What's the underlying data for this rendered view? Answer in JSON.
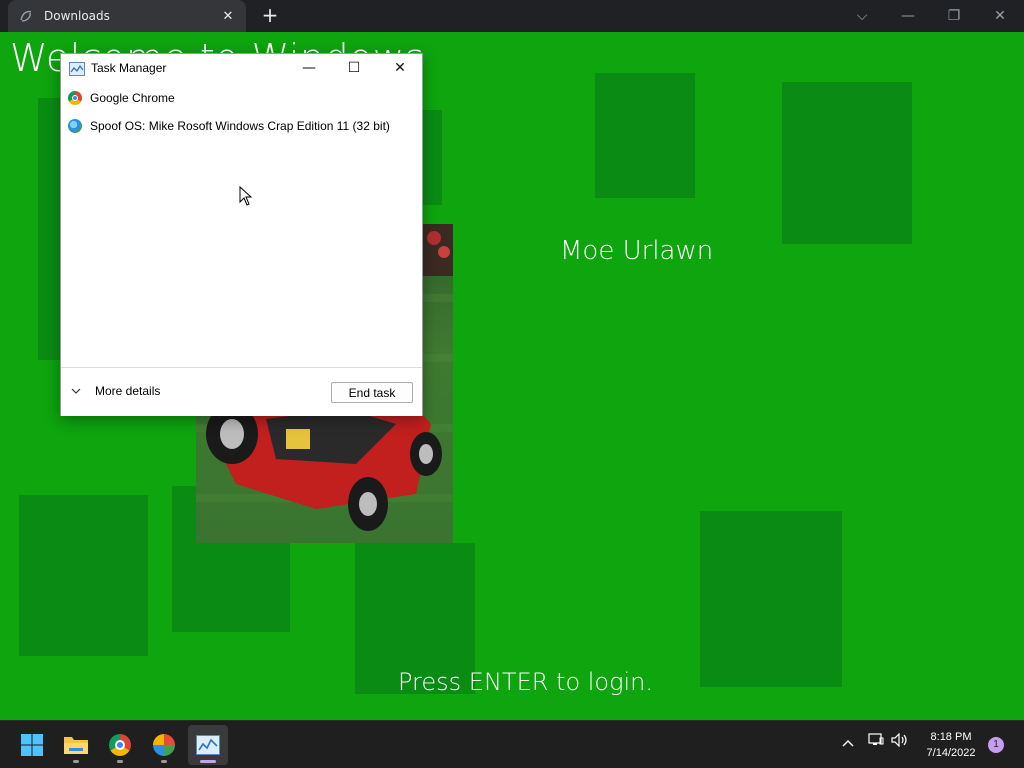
{
  "browser": {
    "tab_title": "Downloads",
    "tab_close": "✕",
    "new_tab": "+",
    "ctrl_dropdown": "⌵",
    "ctrl_minimize": "—",
    "ctrl_restore": "❐",
    "ctrl_close": "✕"
  },
  "lock_screen": {
    "welcome": "Welcome to Windows",
    "user_name": "Moe Urlawn",
    "login_hint": "Press ENTER to login."
  },
  "task_manager": {
    "title": "Task Manager",
    "minimize": "—",
    "maximize": "☐",
    "close": "✕",
    "processes": [
      {
        "name": "Google Chrome"
      },
      {
        "name": "Spoof OS: Mike Rosoft Windows Crap Edition 11 (32 bit)"
      }
    ],
    "more_details": "More details",
    "end_task": "End task"
  },
  "taskbar": {
    "clock_time": "8:18 PM",
    "clock_date": "7/14/2022",
    "notification_count": "1",
    "tray_chevron": "^",
    "tray_network": "▭",
    "tray_volume": "🔊"
  },
  "colors": {
    "desktop_green": "#0ea50e",
    "tile_green": "#0a8c14",
    "taskbar": "#1f1f1f",
    "accent_purple": "#c79df0"
  }
}
